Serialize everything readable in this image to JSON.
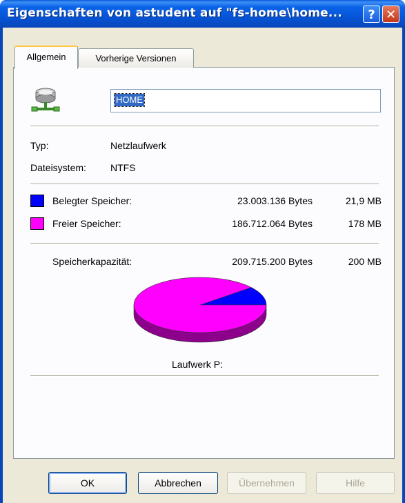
{
  "window": {
    "title": "Eigenschaften von astudent auf \"fs-home\\home...",
    "help_label": "?",
    "close_label": "✕"
  },
  "tabs": [
    {
      "label": "Allgemein",
      "active": true
    },
    {
      "label": "Vorherige Versionen",
      "active": false
    }
  ],
  "drive": {
    "icon": "network-drive-icon",
    "name": "HOME"
  },
  "info": {
    "type_label": "Typ:",
    "type_value": "Netzlaufwerk",
    "fs_label": "Dateisystem:",
    "fs_value": "NTFS"
  },
  "usage": {
    "used": {
      "label": "Belegter Speicher:",
      "bytes": "23.003.136 Bytes",
      "size": "21,9 MB",
      "color": "#0000ff"
    },
    "free": {
      "label": "Freier Speicher:",
      "bytes": "186.712.064 Bytes",
      "size": "178 MB",
      "color": "#ff00ff"
    },
    "capacity": {
      "label": "Speicherkapazität:",
      "bytes": "209.715.200 Bytes",
      "size": "200 MB"
    }
  },
  "chart_data": {
    "type": "pie",
    "categories": [
      "Belegter Speicher",
      "Freier Speicher"
    ],
    "values": [
      23003136,
      186712064
    ],
    "colors": [
      "#0000ff",
      "#ff00ff"
    ]
  },
  "drive_caption": "Laufwerk P:",
  "buttons": {
    "ok": "OK",
    "cancel": "Abbrechen",
    "apply": "Übernehmen",
    "help": "Hilfe"
  }
}
